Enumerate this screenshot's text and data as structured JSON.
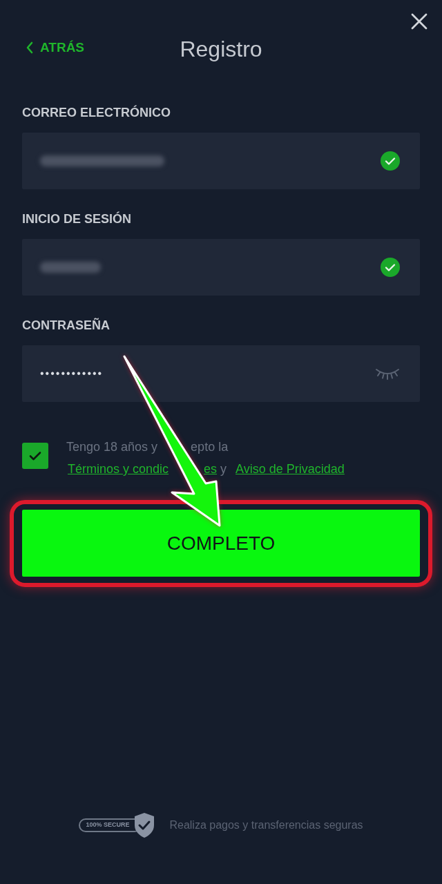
{
  "header": {
    "back_label": "ATRÁS",
    "title": "Registro"
  },
  "fields": [
    {
      "kind": "email",
      "label": "CORREO ELECTRÓNICO",
      "valid": true
    },
    {
      "kind": "login",
      "label": "INICIO DE SESIÓN",
      "valid": true
    },
    {
      "kind": "password",
      "label": "CONTRASEÑA",
      "value": "••••••••••••"
    }
  ],
  "consent": {
    "checked": true,
    "text_parts": [
      "Tengo 18 años y",
      "epto la"
    ],
    "terms_link_parts": [
      "Términos y condic",
      "es"
    ],
    "joiner": "y",
    "privacy_link": "Aviso de Privacidad"
  },
  "submit": {
    "label": "COMPLETO",
    "highlighted": true
  },
  "footer": {
    "badge": "100% SECURE",
    "text": "Realiza pagos y transferencias seguras"
  }
}
